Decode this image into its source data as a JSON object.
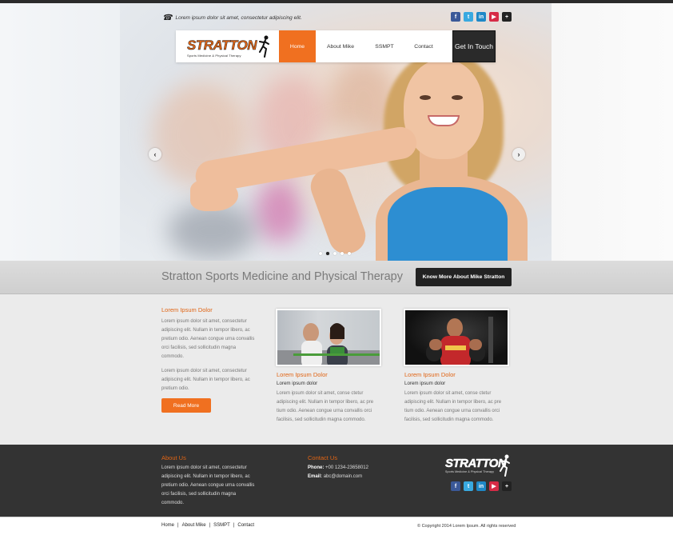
{
  "header": {
    "contact_text": "Lorem ipsum dolor sit amet, consectetur adipiscing elit.",
    "socials": [
      "f",
      "t",
      "in",
      "▶",
      "+"
    ]
  },
  "logo": {
    "name": "STRATTON",
    "tagline": "Sports Medicine & Physical Therapy"
  },
  "nav": {
    "items": [
      "Home",
      "About Mike",
      "SSMPT",
      "Contact"
    ],
    "active": "Home",
    "cta": "Get In Touch"
  },
  "slider": {
    "prev": "‹",
    "next": "›",
    "slide_count": 5,
    "active_slide": 2
  },
  "band": {
    "title": "Stratton Sports Medicine and Physical Therapy",
    "button": "Know More About Mike Stratton"
  },
  "content": {
    "col1": {
      "title": "Lorem Ipsum Dolor",
      "para1": "Lorem ipsum dolor sit amet, consectetur adipiscing elit. Nullam in tempor libero, ac pretium odio. Aenean congue urna convallis orci facilisis, sed sollicitudin magna commodo.",
      "para2": "Lorem ipsum dolor sit amet, consectetur adipiscing elit. Nullam in tempor libero, ac pretium odio.",
      "button": "Read More"
    },
    "col2": {
      "title": "Lorem Ipsum Dolor",
      "subtitle": "Lorem ipsum dolor",
      "para": "Lorem ipsum dolor sit amet, conse ctetur adipiscing elit. Nullam in tempor libero, ac pre tium odio. Aenean congue urna convallis orci facilisis, sed sollicitudin magna commodo."
    },
    "col3": {
      "title": "Lorem Ipsum Dolor",
      "subtitle": "Lorem ipsum dolor",
      "para": "Lorem ipsum dolor sit amet, conse ctetur adipiscing elit. Nullam in tempor libero, ac pre tium odio. Aenean congue urna convallis orci facilisis, sed sollicitudin magna commodo."
    }
  },
  "footer": {
    "about_title": "About Us",
    "about_text": "Lorem ipsum dolor sit amet, consectetur adipiscing elit. Nullam in tempor libero, ac pretium odio. Aenean congue urna convallis orci facilisis, sed sollicitudin magna commodo.",
    "contact_title": "Contact Us",
    "phone_label": "Phone:",
    "phone": "+00 1234-23658012",
    "email_label": "Email:",
    "email": "abc@domain.com",
    "logo_name": "STRATTON",
    "logo_tagline": "Sports Medicine & Physical Therapy"
  },
  "bottom": {
    "links": [
      "Home",
      "About Mike",
      "SSMPT",
      "Contact"
    ],
    "separator": "|",
    "copyright": "© Copyright 2014 Lorem Ipsum. All rights reserved"
  },
  "colors": {
    "accent": "#f07020",
    "dark": "#2a2a2a",
    "footer": "#333333"
  }
}
